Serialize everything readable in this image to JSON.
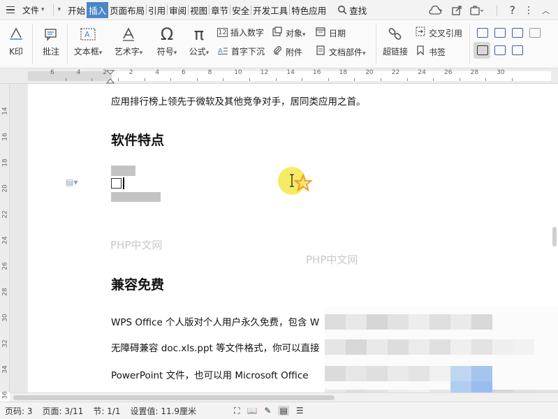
{
  "menubar": {
    "file_label": "文件",
    "tabs": [
      "开始",
      "插入",
      "页面布局",
      "引用",
      "审阅",
      "视图",
      "章节",
      "安全",
      "开发工具",
      "特色应用"
    ],
    "active_tab": "插入",
    "search_label": "查找"
  },
  "ribbon": {
    "first_label": "K印",
    "comment": "批注",
    "textbox": "文本框",
    "wordart": "艺术字",
    "symbol": "符号",
    "formula": "公式",
    "insert_number": "插入数字",
    "object": "对象",
    "date": "日期",
    "dropcap": "首字下沉",
    "attachment": "附件",
    "docparts": "文档部件",
    "hyperlink": "超链接",
    "crossref": "交叉引用",
    "bookmark": "书签"
  },
  "ruler": {
    "h_numbers": [
      "6",
      "4",
      "2",
      "2",
      "4",
      "6",
      "8",
      "10",
      "12",
      "14",
      "16",
      "18",
      "20",
      "22",
      "24",
      "26",
      "28",
      "30"
    ],
    "v_numbers": [
      "14",
      "16",
      "18",
      "20",
      "22",
      "24",
      "26",
      "28",
      "30",
      "32",
      "34",
      "36",
      "38"
    ]
  },
  "document": {
    "line1": "应用排行榜上领先于微软及其他竞争对手，居同类应用之首。",
    "heading1": "软件特点",
    "heading2": "兼容免费",
    "para1": "WPS Office 个人版对个人用户永久免费，包含  W",
    "para2": "无障碍兼容 doc.xls.ppt 等文件格式，你可以直接",
    "para3": "PowerPoint  文件，也可以用  Microsoft Office",
    "watermark": "PHP中文网"
  },
  "statusbar": {
    "page_code": "页码: 3",
    "page": "页面: 3/11",
    "section": "节: 1/1",
    "setting": "设置值: 11.9厘米"
  },
  "colors": {
    "accent": "#4a86c8",
    "highlight": "#f5e84a",
    "star": "#f0a030"
  }
}
